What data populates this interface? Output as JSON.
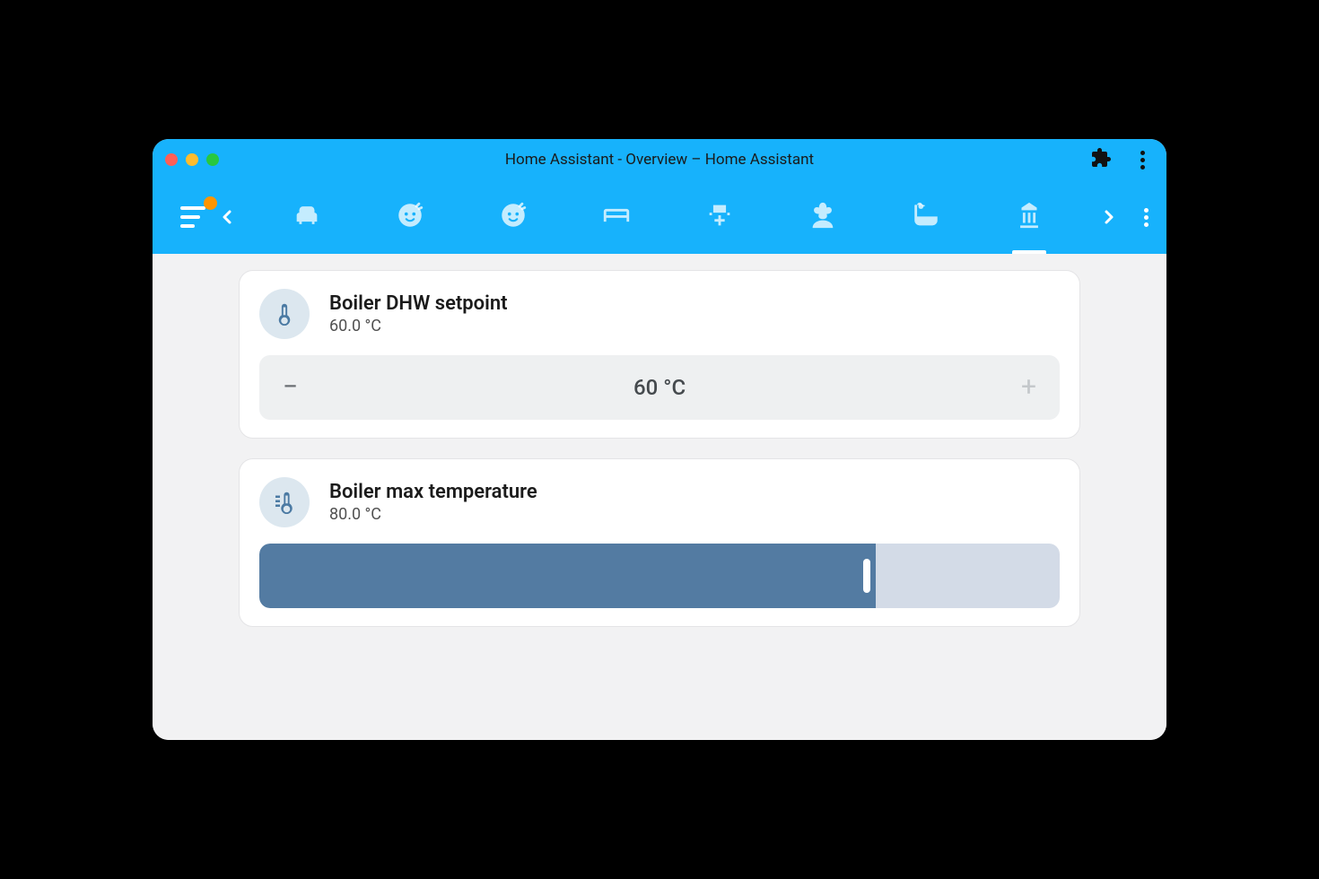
{
  "window": {
    "title": "Home Assistant - Overview – Home Assistant"
  },
  "nav": {
    "has_notification": true,
    "tabs": [
      {
        "name": "sofa-icon",
        "active": false
      },
      {
        "name": "child1-icon",
        "active": false
      },
      {
        "name": "child2-icon",
        "active": false
      },
      {
        "name": "bed-icon",
        "active": false
      },
      {
        "name": "office-chair-icon",
        "active": false
      },
      {
        "name": "flower-icon",
        "active": false
      },
      {
        "name": "bathtub-icon",
        "active": false
      },
      {
        "name": "utility-icon",
        "active": true
      }
    ]
  },
  "cards": {
    "dhw": {
      "title": "Boiler DHW setpoint",
      "value_text": "60.0 °C",
      "stepper_display": "60 °C"
    },
    "maxtemp": {
      "title": "Boiler max temperature",
      "value_text": "80.0 °C",
      "slider_percent": 77
    }
  }
}
